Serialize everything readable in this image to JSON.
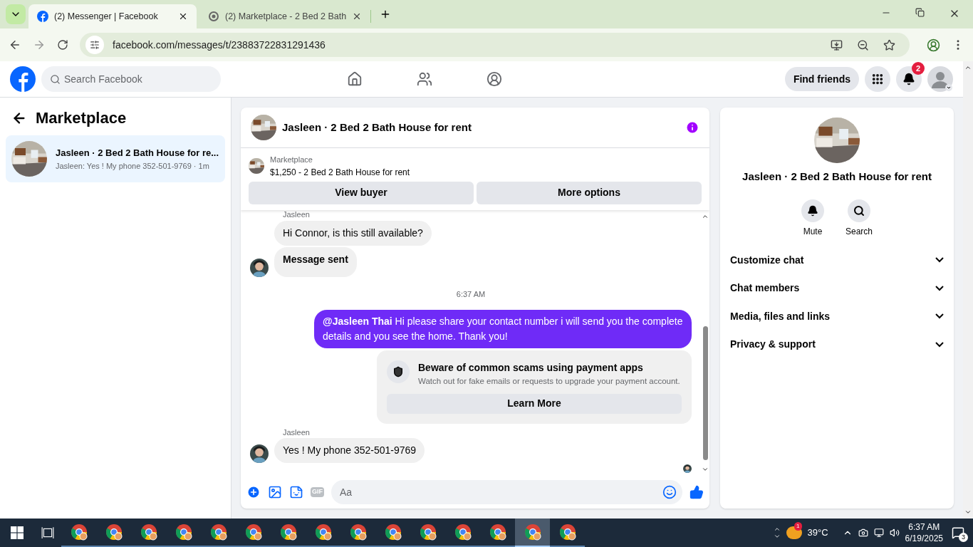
{
  "browser": {
    "tabs": [
      {
        "title": "(2) Messenger | Facebook",
        "selected": true
      },
      {
        "title": "(2) Marketplace - 2 Bed 2 Bath",
        "selected": false
      }
    ],
    "url": "facebook.com/messages/t/23883722831291436"
  },
  "header": {
    "search_placeholder": "Search Facebook",
    "find_friends": "Find friends",
    "notification_count": "2"
  },
  "sidebar": {
    "title": "Marketplace",
    "conversations": [
      {
        "title": "Jasleen · 2 Bed 2 Bath House for re...",
        "preview": "Jasleen: Yes ! My phone 352-501-9769 · 1m",
        "selected": true
      }
    ]
  },
  "chat": {
    "title": "Jasleen · 2 Bed 2 Bath House for rent",
    "listing": {
      "label": "Marketplace",
      "text": "$1,250 - 2 Bed 2 Bath House for rent"
    },
    "buttons": [
      "View buyer",
      "More options"
    ],
    "messages": [
      {
        "kind": "sender",
        "text": "Jasleen"
      },
      {
        "kind": "incoming",
        "text": "Hi Connor, is this still available?",
        "avatar": false,
        "bold": false
      },
      {
        "kind": "incoming",
        "text": "Message sent",
        "avatar": true,
        "bold": true
      },
      {
        "kind": "timestamp",
        "text": "6:37 AM"
      },
      {
        "kind": "outgoing",
        "text": "**@Jasleen Thai** Hi please share your contact number i will send you the complete details and you see the home. Thank you!"
      },
      {
        "kind": "notice",
        "title": "Beware of common scams using payment apps",
        "text": "Watch out for fake emails or requests to upgrade your payment account.",
        "button": "Learn More"
      },
      {
        "kind": "sender",
        "text": "Jasleen"
      },
      {
        "kind": "incoming",
        "text": "Yes ! My phone 352-501-9769",
        "avatar": true,
        "bold": false
      },
      {
        "kind": "receipt"
      }
    ],
    "gif_label": "GIF",
    "composer_placeholder": "Aa"
  },
  "details": {
    "title": "Jasleen · 2 Bed 2 Bath House for rent",
    "actions": [
      {
        "kind": "mute",
        "label": "Mute"
      },
      {
        "kind": "search",
        "label": "Search"
      }
    ],
    "sections": [
      {
        "label": "Customize chat",
        "expanded": false
      },
      {
        "label": "Chat members",
        "expanded": false
      },
      {
        "label": "Media, files and links",
        "expanded": false
      },
      {
        "label": "Privacy & support",
        "expanded": false
      }
    ]
  },
  "taskbar": {
    "apps": [
      {
        "selected": false
      },
      {
        "selected": false
      },
      {
        "selected": false
      },
      {
        "selected": false
      },
      {
        "selected": false
      },
      {
        "selected": false
      },
      {
        "selected": false
      },
      {
        "selected": false
      },
      {
        "selected": false
      },
      {
        "selected": false
      },
      {
        "selected": false
      },
      {
        "selected": false
      },
      {
        "selected": false
      },
      {
        "selected": true
      },
      {
        "selected": false
      }
    ],
    "weather_badge": "1",
    "temperature": "39°C",
    "time": "6:37 AM",
    "date": "6/19/2025",
    "notification_count": "3"
  }
}
